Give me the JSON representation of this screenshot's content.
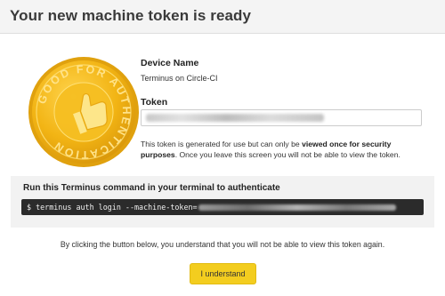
{
  "header": {
    "title": "Your new machine token is ready"
  },
  "badge": {
    "text": "GOOD FOR AUTHENTICATION",
    "icon": "thumbs-up-icon"
  },
  "device": {
    "label": "Device Name",
    "value": "Terminus on Circle-CI"
  },
  "token": {
    "label": "Token"
  },
  "note": {
    "text_before": "This token is generated for use but can only be ",
    "text_bold": "viewed once for security purposes",
    "text_after": ". Once you leave this screen you will not be able to view the token."
  },
  "command": {
    "heading": "Run this Terminus command in your terminal to authenticate",
    "prefix": "$ terminus auth login --machine-token="
  },
  "footer": {
    "text": "By clicking the button below, you understand that you will not be able to view this token again."
  },
  "actions": {
    "confirm_label": "I understand"
  },
  "colors": {
    "accent": "#f3cd1f",
    "header_bg": "#f4f4f4",
    "command_bg": "#2b2b2b",
    "section_bg": "#f2f2f2"
  }
}
